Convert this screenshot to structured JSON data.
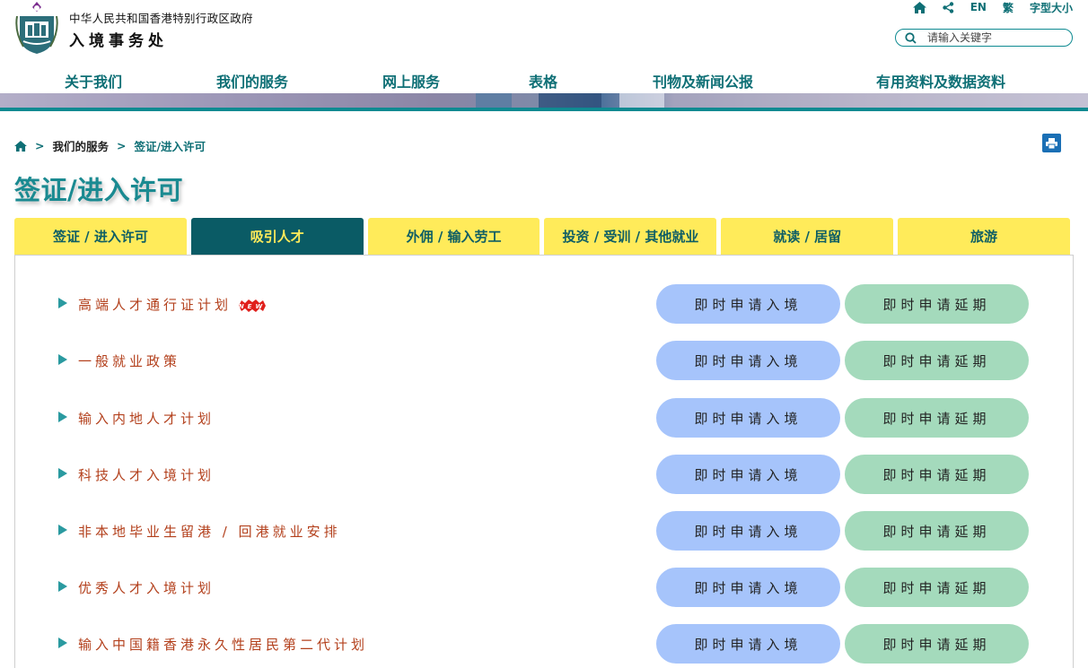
{
  "header": {
    "org_full": "中华人民共和国香港特别行政区政府",
    "org_name": "入境事务处",
    "util": {
      "lang_en": "EN",
      "lang_trad": "繁",
      "font_size": "字型大小"
    },
    "search_placeholder": "请输入关键字"
  },
  "nav": [
    "关于我们",
    "我们的服务",
    "网上服务",
    "表格",
    "刊物及新闻公报",
    "有用资料及数据资料"
  ],
  "breadcrumb": {
    "level1": "我们的服务",
    "level2": "签证/进入许可"
  },
  "page_title": "签证/进入许可",
  "tabs": [
    "签证 / 进入许可",
    "吸引人才",
    "外佣 / 输入劳工",
    "投资 / 受训 / 其他就业",
    "就读 / 居留",
    "旅游"
  ],
  "active_tab": "吸引人才",
  "buttons": {
    "apply_entry": "即时申请入境",
    "apply_extension": "即时申请延期"
  },
  "items": [
    {
      "label": "高端人才通行证计划",
      "new_badge": "NEW"
    },
    {
      "label": "一般就业政策"
    },
    {
      "label": "输入内地人才计划"
    },
    {
      "label": "科技人才入境计划"
    },
    {
      "label": "非本地毕业生留港 / 回港就业安排"
    },
    {
      "label": "优秀人才入境计划"
    },
    {
      "label": "输入中国籍香港永久性居民第二代计划"
    }
  ],
  "colors": {
    "teal": "#0e6f75",
    "tab_yellow": "#ffeb5a",
    "tab_active": "#0a5b65",
    "entry_btn": "#a6c4fb",
    "extend_btn": "#a4dabc",
    "item_text": "#b3401c"
  }
}
